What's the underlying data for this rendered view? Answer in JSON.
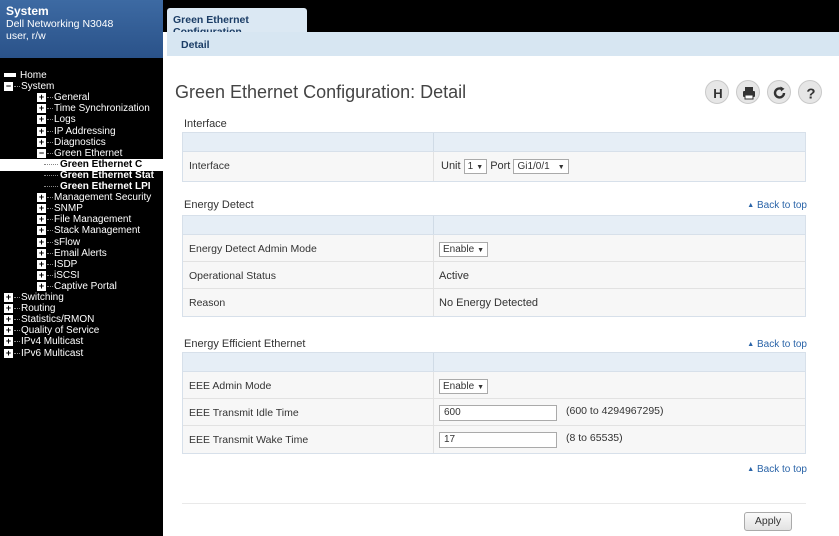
{
  "sidebar": {
    "system_title": "System",
    "model": "Dell Networking N3048",
    "user": "user, r/w",
    "tree": [
      {
        "label": "Home",
        "expander": ""
      },
      {
        "label": "System",
        "expander": "−"
      },
      {
        "label": "General",
        "expander": "+"
      },
      {
        "label": "Time Synchronization",
        "expander": "+"
      },
      {
        "label": "Logs",
        "expander": "+"
      },
      {
        "label": "IP Addressing",
        "expander": "+"
      },
      {
        "label": "Diagnostics",
        "expander": "+"
      },
      {
        "label": "Green Ethernet",
        "expander": "−"
      },
      {
        "label": "Green Ethernet C",
        "expander": ""
      },
      {
        "label": "Green Ethernet Stat",
        "expander": ""
      },
      {
        "label": "Green Ethernet LPI",
        "expander": ""
      },
      {
        "label": "Management Security",
        "expander": "+"
      },
      {
        "label": "SNMP",
        "expander": "+"
      },
      {
        "label": "File Management",
        "expander": "+"
      },
      {
        "label": "Stack Management",
        "expander": "+"
      },
      {
        "label": "sFlow",
        "expander": "+"
      },
      {
        "label": "Email Alerts",
        "expander": "+"
      },
      {
        "label": "ISDP",
        "expander": "+"
      },
      {
        "label": "iSCSI",
        "expander": "+"
      },
      {
        "label": "Captive Portal",
        "expander": "+"
      },
      {
        "label": "Switching",
        "expander": "+"
      },
      {
        "label": "Routing",
        "expander": "+"
      },
      {
        "label": "Statistics/RMON",
        "expander": "+"
      },
      {
        "label": "Quality of Service",
        "expander": "+"
      },
      {
        "label": "IPv4 Multicast",
        "expander": "+"
      },
      {
        "label": "IPv6 Multicast",
        "expander": "+"
      }
    ]
  },
  "tabs": {
    "active": "Green Ethernet Configuration",
    "sub": "Detail"
  },
  "main": {
    "title": "Green Ethernet Configuration: Detail",
    "toolbar_icons": [
      "save-icon",
      "print-icon",
      "refresh-icon",
      "help-icon"
    ],
    "interface_section": {
      "title": "Interface",
      "row_label": "Interface",
      "unit_label": "Unit",
      "unit_value": "1",
      "port_label": "Port",
      "port_value": "Gi1/0/1"
    },
    "energy_detect": {
      "title": "Energy Detect",
      "back_to_top": "Back to top",
      "admin_mode_label": "Energy Detect Admin Mode",
      "admin_mode_value": "Enable",
      "op_status_label": "Operational Status",
      "op_status_value": "Active",
      "reason_label": "Reason",
      "reason_value": "No Energy Detected"
    },
    "eee": {
      "title": "Energy Efficient Ethernet",
      "back_to_top": "Back to top",
      "admin_mode_label": "EEE Admin Mode",
      "admin_mode_value": "Enable",
      "idle_label": "EEE Transmit Idle Time",
      "idle_value": "600",
      "idle_range": "(600 to 4294967295)",
      "wake_label": "EEE Transmit Wake Time",
      "wake_value": "17",
      "wake_range": "(8 to 65535)"
    },
    "bottom_back_to_top": "Back to top",
    "apply_label": "Apply"
  }
}
